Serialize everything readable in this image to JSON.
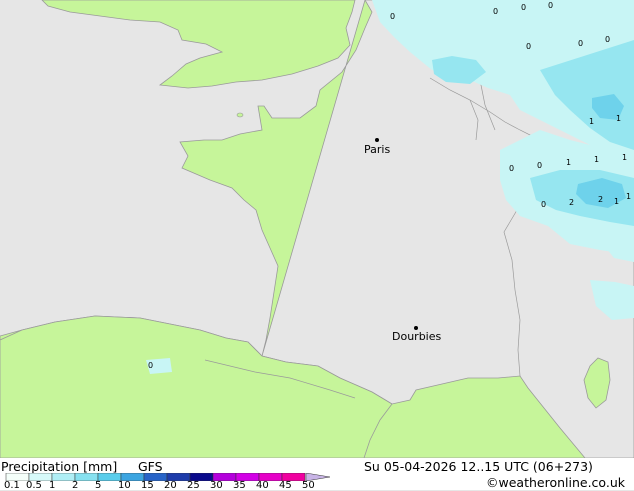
{
  "map": {
    "cities": [
      {
        "id": "paris",
        "name": "Paris"
      },
      {
        "id": "dourbies",
        "name": "Dourbies"
      }
    ],
    "values": [
      "0",
      "0",
      "0",
      "0",
      "0",
      "0",
      "0",
      "1",
      "1",
      "1",
      "1",
      "1",
      "1",
      "2",
      "2",
      "1",
      "0",
      "0",
      "0",
      "0"
    ],
    "colors": {
      "sea": "#e6e6e6",
      "land": "#c6f59a",
      "coast": "#9a9a9a",
      "precip_light": "#c8f5f5",
      "precip_mid": "#96e6f0",
      "precip_high": "#6ed2eb"
    }
  },
  "footer": {
    "title": "Precipitation [mm]",
    "model": "GFS",
    "datetime": "Su 05-04-2026 12..15 UTC (06+273)",
    "credit": "©weatheronline.co.uk",
    "scale_labels": [
      "0.1",
      "0.5",
      "1",
      "2",
      "5",
      "10",
      "15",
      "20",
      "25",
      "30",
      "35",
      "40",
      "45",
      "50"
    ],
    "scale_colors": [
      "#f5fffa",
      "#d7fafa",
      "#afeef5",
      "#87e1f0",
      "#5acdeb",
      "#3ca5e1",
      "#2864c8",
      "#1e3caa",
      "#0a0a8c",
      "#b400dc",
      "#d200e6",
      "#e600c8",
      "#f000a0",
      "#c8b4e6"
    ]
  }
}
